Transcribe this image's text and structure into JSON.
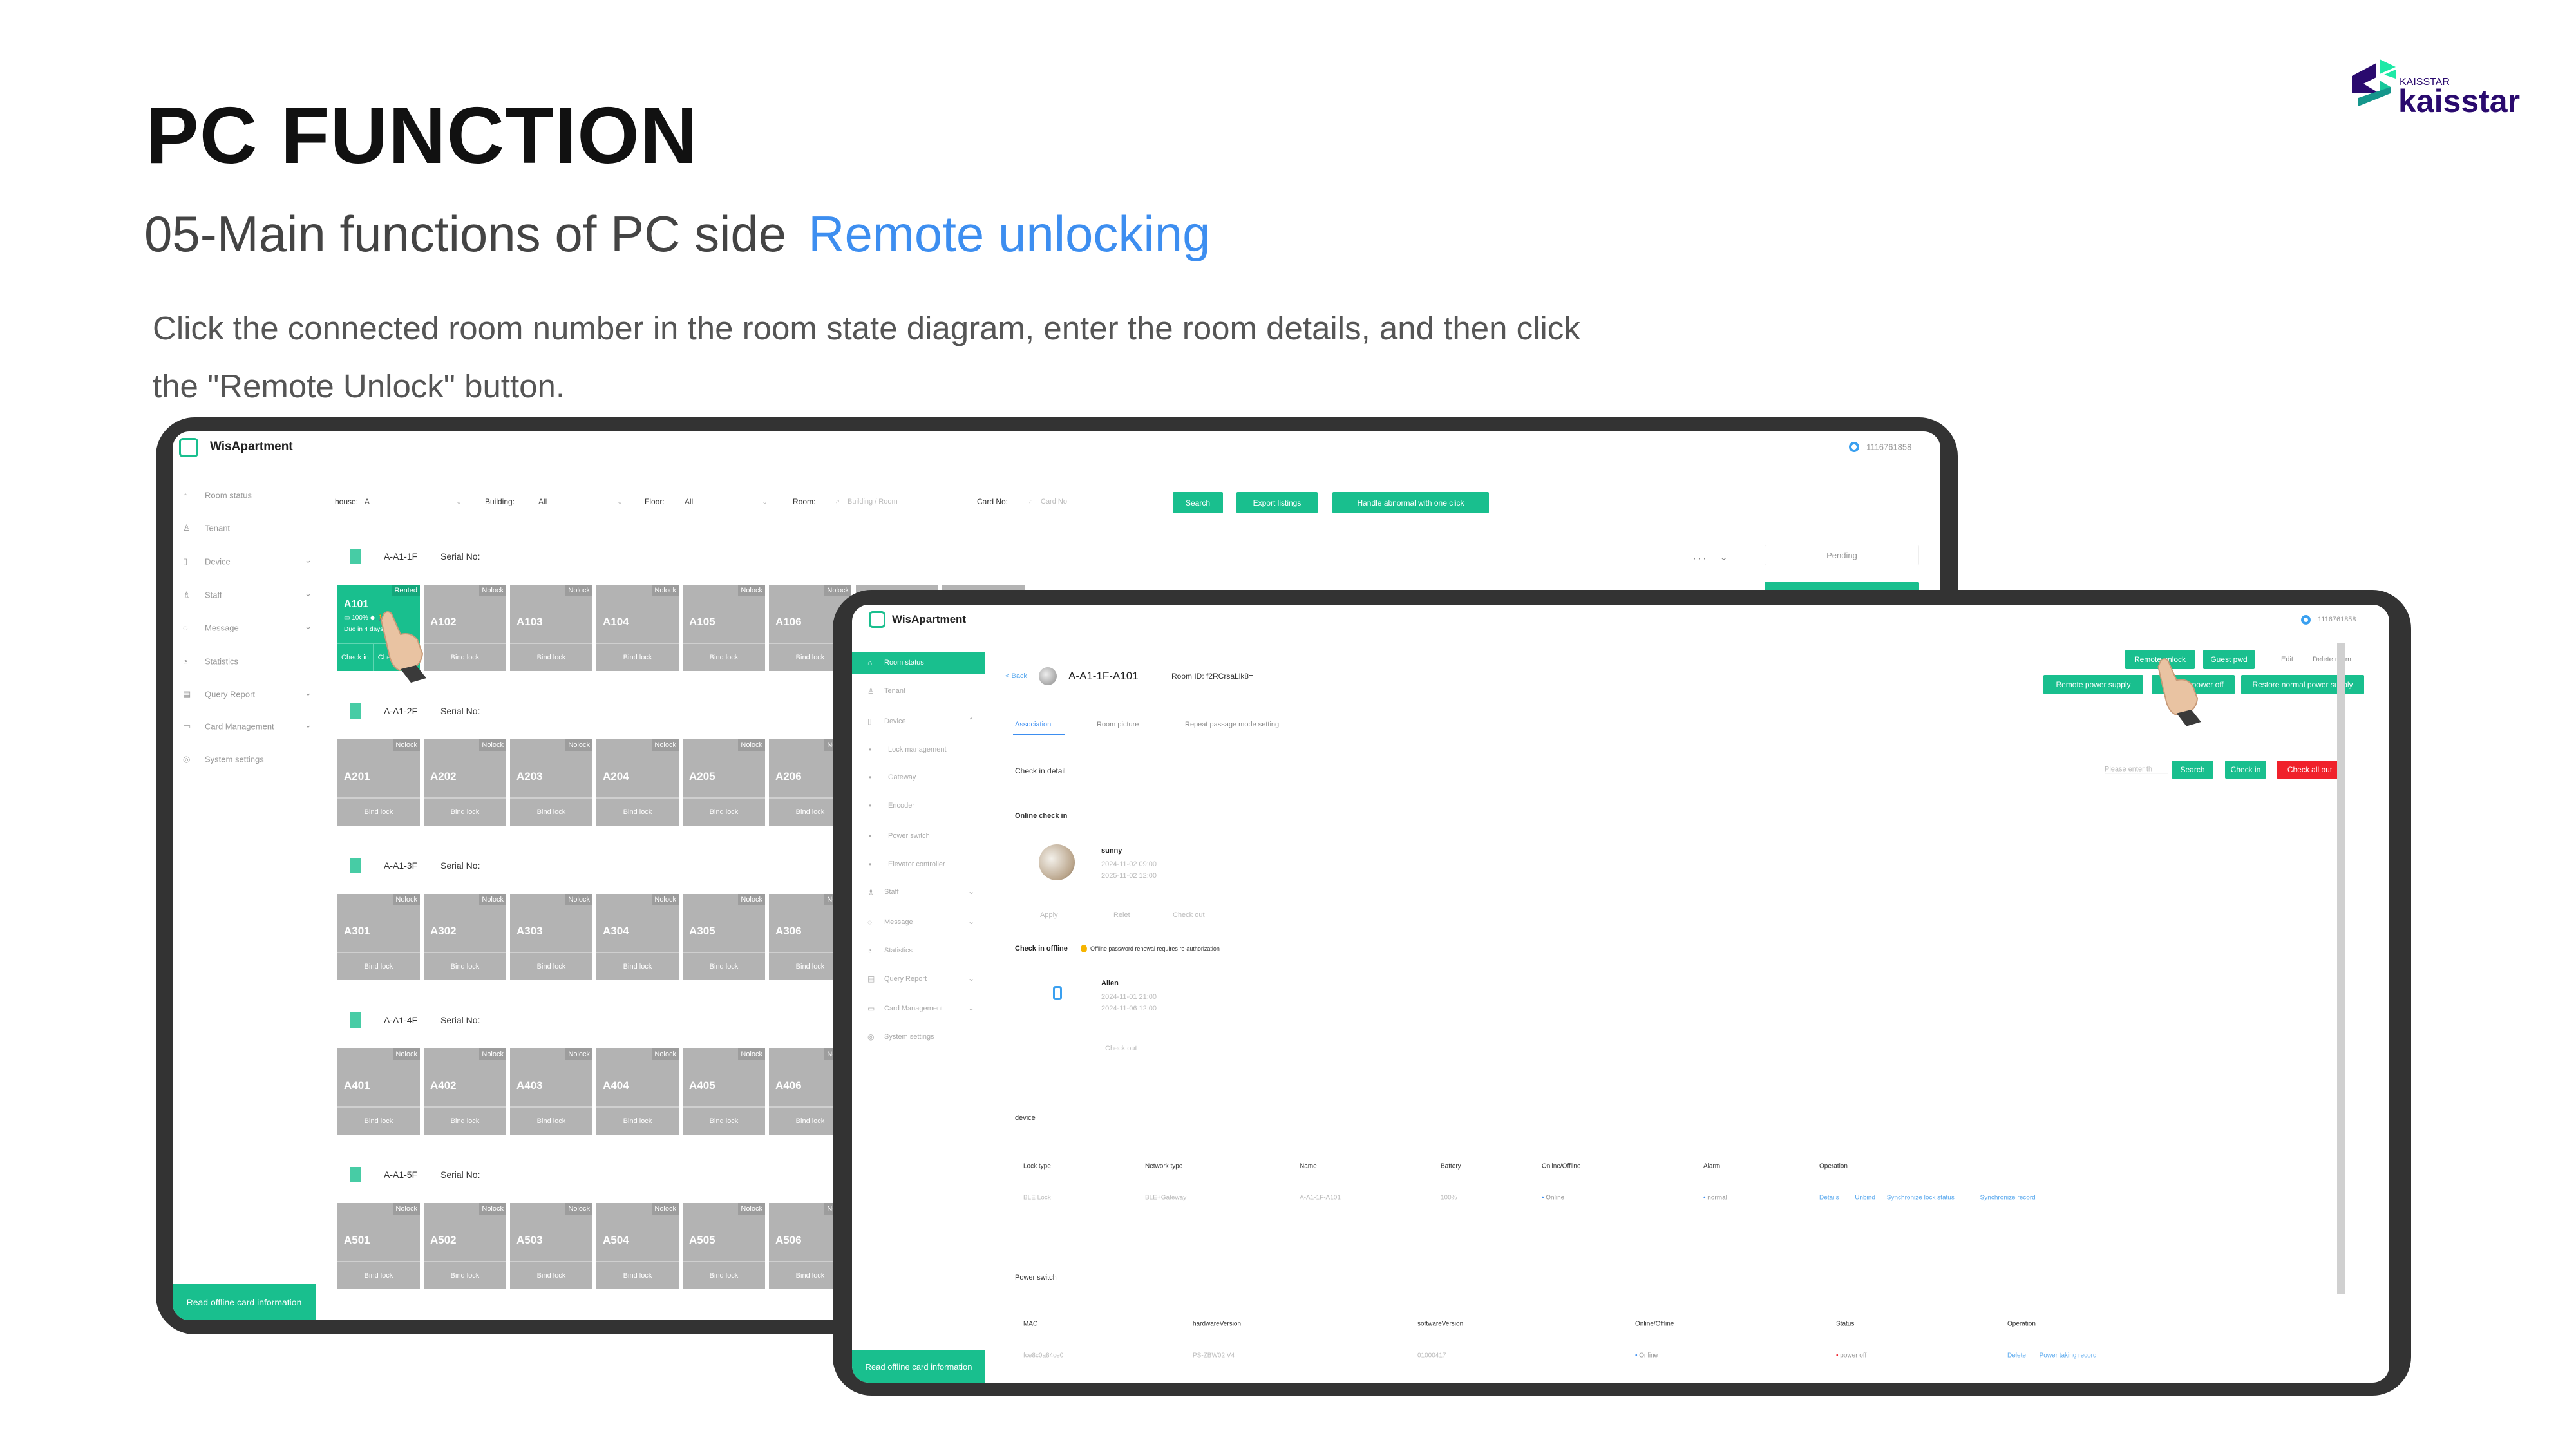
{
  "slide": {
    "title": "PC FUNCTION",
    "subtitle": "05-Main functions of PC side",
    "subtitle_highlight": "Remote unlocking",
    "description_lines": [
      "Click the connected room number in the room state diagram, enter the room details, and then click",
      "the \"Remote Unlock\" button."
    ]
  },
  "logo": {
    "small": "KAISSTAR",
    "name": "kaisstar"
  },
  "colors": {
    "accent_green": "#19bf8e",
    "highlight_blue": "#3d8ef0",
    "danger_red": "#f0212b",
    "logo_purple": "#2a0a6e",
    "tile_gray": "#b3b3b3"
  },
  "window1": {
    "app_name": "WisApartment",
    "user_id": "1116761858",
    "sidebar": [
      {
        "label": "Room status",
        "icon": "home-icon"
      },
      {
        "label": "Tenant",
        "icon": "user-icon"
      },
      {
        "label": "Device",
        "icon": "device-icon",
        "chevron": true
      },
      {
        "label": "Staff",
        "icon": "staff-icon",
        "chevron": true
      },
      {
        "label": "Message",
        "icon": "bell-icon",
        "chevron": true
      },
      {
        "label": "Statistics",
        "icon": "chart-icon"
      },
      {
        "label": "Query Report",
        "icon": "report-icon",
        "chevron": true
      },
      {
        "label": "Card Management",
        "icon": "card-icon",
        "chevron": true
      },
      {
        "label": "System settings",
        "icon": "settings-icon"
      }
    ],
    "filters": {
      "house_label": "house:",
      "house_value": "A",
      "building_label": "Building:",
      "building_value": "All",
      "floor_label": "Floor:",
      "floor_value": "All",
      "room_label": "Room:",
      "room_placeholder": "Building / Room",
      "card_label": "Card No:",
      "card_placeholder": "Card No"
    },
    "buttons": {
      "search": "Search",
      "export": "Export listings",
      "handle": "Handle abnormal with one click"
    },
    "pending_label": "Pending",
    "read_offline": "Read offline card information",
    "floors": [
      {
        "name": "A-A1-1F",
        "serial": "Serial No:",
        "rooms": [
          {
            "num": "A101",
            "tag": "Rented",
            "rented": true,
            "battery": "100%",
            "due": "Due in 4 days",
            "actions": [
              "Check in",
              "Check out"
            ]
          },
          {
            "num": "A102",
            "tag": "Nolock",
            "bottom": "Bind lock"
          },
          {
            "num": "A103",
            "tag": "Nolock",
            "bottom": "Bind lock"
          },
          {
            "num": "A104",
            "tag": "Nolock",
            "bottom": "Bind lock"
          },
          {
            "num": "A105",
            "tag": "Nolock",
            "bottom": "Bind lock"
          },
          {
            "num": "A106",
            "tag": "Nolock",
            "bottom": "Bind lock"
          }
        ]
      },
      {
        "name": "A-A1-2F",
        "serial": "Serial No:",
        "rooms": [
          {
            "num": "A201",
            "tag": "Nolock",
            "bottom": "Bind lock"
          },
          {
            "num": "A202",
            "tag": "Nolock",
            "bottom": "Bind lock"
          },
          {
            "num": "A203",
            "tag": "Nolock",
            "bottom": "Bind lock"
          },
          {
            "num": "A204",
            "tag": "Nolock",
            "bottom": "Bind lock"
          },
          {
            "num": "A205",
            "tag": "Nolock",
            "bottom": "Bind lock"
          },
          {
            "num": "A206",
            "tag": "Nolock",
            "bottom": "Bind lock"
          }
        ]
      },
      {
        "name": "A-A1-3F",
        "serial": "Serial No:",
        "rooms": [
          {
            "num": "A301",
            "tag": "Nolock",
            "bottom": "Bind lock"
          },
          {
            "num": "A302",
            "tag": "Nolock",
            "bottom": "Bind lock"
          },
          {
            "num": "A303",
            "tag": "Nolock",
            "bottom": "Bind lock"
          },
          {
            "num": "A304",
            "tag": "Nolock",
            "bottom": "Bind lock"
          },
          {
            "num": "A305",
            "tag": "Nolock",
            "bottom": "Bind lock"
          },
          {
            "num": "A306",
            "tag": "Nolock",
            "bottom": "Bind lock"
          }
        ]
      },
      {
        "name": "A-A1-4F",
        "serial": "Serial No:",
        "rooms": [
          {
            "num": "A401",
            "tag": "Nolock",
            "bottom": "Bind lock"
          },
          {
            "num": "A402",
            "tag": "Nolock",
            "bottom": "Bind lock"
          },
          {
            "num": "A403",
            "tag": "Nolock",
            "bottom": "Bind lock"
          },
          {
            "num": "A404",
            "tag": "Nolock",
            "bottom": "Bind lock"
          },
          {
            "num": "A405",
            "tag": "Nolock",
            "bottom": "Bind lock"
          },
          {
            "num": "A406",
            "tag": "Nolock",
            "bottom": "Bind lock"
          }
        ]
      },
      {
        "name": "A-A1-5F",
        "serial": "Serial No:",
        "rooms": [
          {
            "num": "A501",
            "tag": "Nolock",
            "bottom": "Bind lock"
          },
          {
            "num": "A502",
            "tag": "Nolock",
            "bottom": "Bind lock"
          },
          {
            "num": "A503",
            "tag": "Nolock",
            "bottom": "Bind lock"
          },
          {
            "num": "A504",
            "tag": "Nolock",
            "bottom": "Bind lock"
          },
          {
            "num": "A505",
            "tag": "Nolock",
            "bottom": "Bind lock"
          },
          {
            "num": "A506",
            "tag": "Nolock",
            "bottom": "Bind lock"
          }
        ]
      }
    ]
  },
  "window2": {
    "app_name": "WisApartment",
    "user_id": "1116761858",
    "sidebar": [
      {
        "label": "Room status",
        "icon": "home-icon",
        "active": true
      },
      {
        "label": "Tenant",
        "icon": "user-icon"
      },
      {
        "label": "Device",
        "icon": "device-icon",
        "chevron": "up"
      },
      {
        "label": "Lock management",
        "sub": true
      },
      {
        "label": "Gateway",
        "sub": true
      },
      {
        "label": "Encoder",
        "sub": true
      },
      {
        "label": "Power switch",
        "sub": true
      },
      {
        "label": "Elevator controller",
        "sub": true
      },
      {
        "label": "Staff",
        "icon": "staff-icon",
        "chevron": true
      },
      {
        "label": "Message",
        "icon": "bell-icon",
        "chevron": true
      },
      {
        "label": "Statistics",
        "icon": "chart-icon"
      },
      {
        "label": "Query Report",
        "icon": "report-icon",
        "chevron": true
      },
      {
        "label": "Card Management",
        "icon": "card-icon",
        "chevron": true
      },
      {
        "label": "System settings",
        "icon": "settings-icon"
      }
    ],
    "read_offline": "Read offline card information",
    "back": "< Back",
    "room_name": "A-A1-1F-A101",
    "room_id": "Room ID: f2RCrsaLlk8=",
    "actions_row1": [
      "Remote unlock",
      "Guest pwd"
    ],
    "edit": "Edit",
    "delete_room": "Delete room",
    "actions_row2": [
      "Remote power supply",
      "Remote power off",
      "Restore normal power supply"
    ],
    "tabs": [
      "Association",
      "Room picture",
      "Repeat passage mode setting"
    ],
    "check_in_detail": "Check in detail",
    "search_placeholder": "Please enter th",
    "search": "Search",
    "check_in": "Check in",
    "check_all_out": "Check all out",
    "online_check_in": "Online check in",
    "online_guest": {
      "name": "sunny",
      "start": "2024-11-02 09:00",
      "end": "2025-11-02 12:00",
      "actions": [
        "Apply",
        "Relet",
        "Check out"
      ]
    },
    "offline_check_in": "Check in offline",
    "offline_note": "Offline password renewal requires re-authorization",
    "offline_guest": {
      "name": "Allen",
      "start": "2024-11-01 21:00",
      "end": "2024-11-06 12:00",
      "action": "Check out"
    },
    "device_label": "device",
    "device_table": {
      "headers": [
        "Lock type",
        "Network type",
        "Name",
        "Battery",
        "Online/Offline",
        "Alarm",
        "Operation"
      ],
      "row": [
        "BLE Lock",
        "BLE+Gateway",
        "A-A1-1F-A101",
        "100%",
        "Online",
        "normal"
      ],
      "operations": [
        "Details",
        "Unbind",
        "Synchronize lock status",
        "Synchronize record"
      ]
    },
    "power_label": "Power switch",
    "power_table": {
      "headers": [
        "MAC",
        "hardwareVersion",
        "softwareVersion",
        "Online/Offline",
        "Status",
        "Operation"
      ],
      "row": [
        "fce8c0a84ce0",
        "PS-ZBW02 V4",
        "01000417",
        "Online",
        "power off"
      ],
      "operations": [
        "Delete",
        "Power taking record"
      ]
    }
  }
}
